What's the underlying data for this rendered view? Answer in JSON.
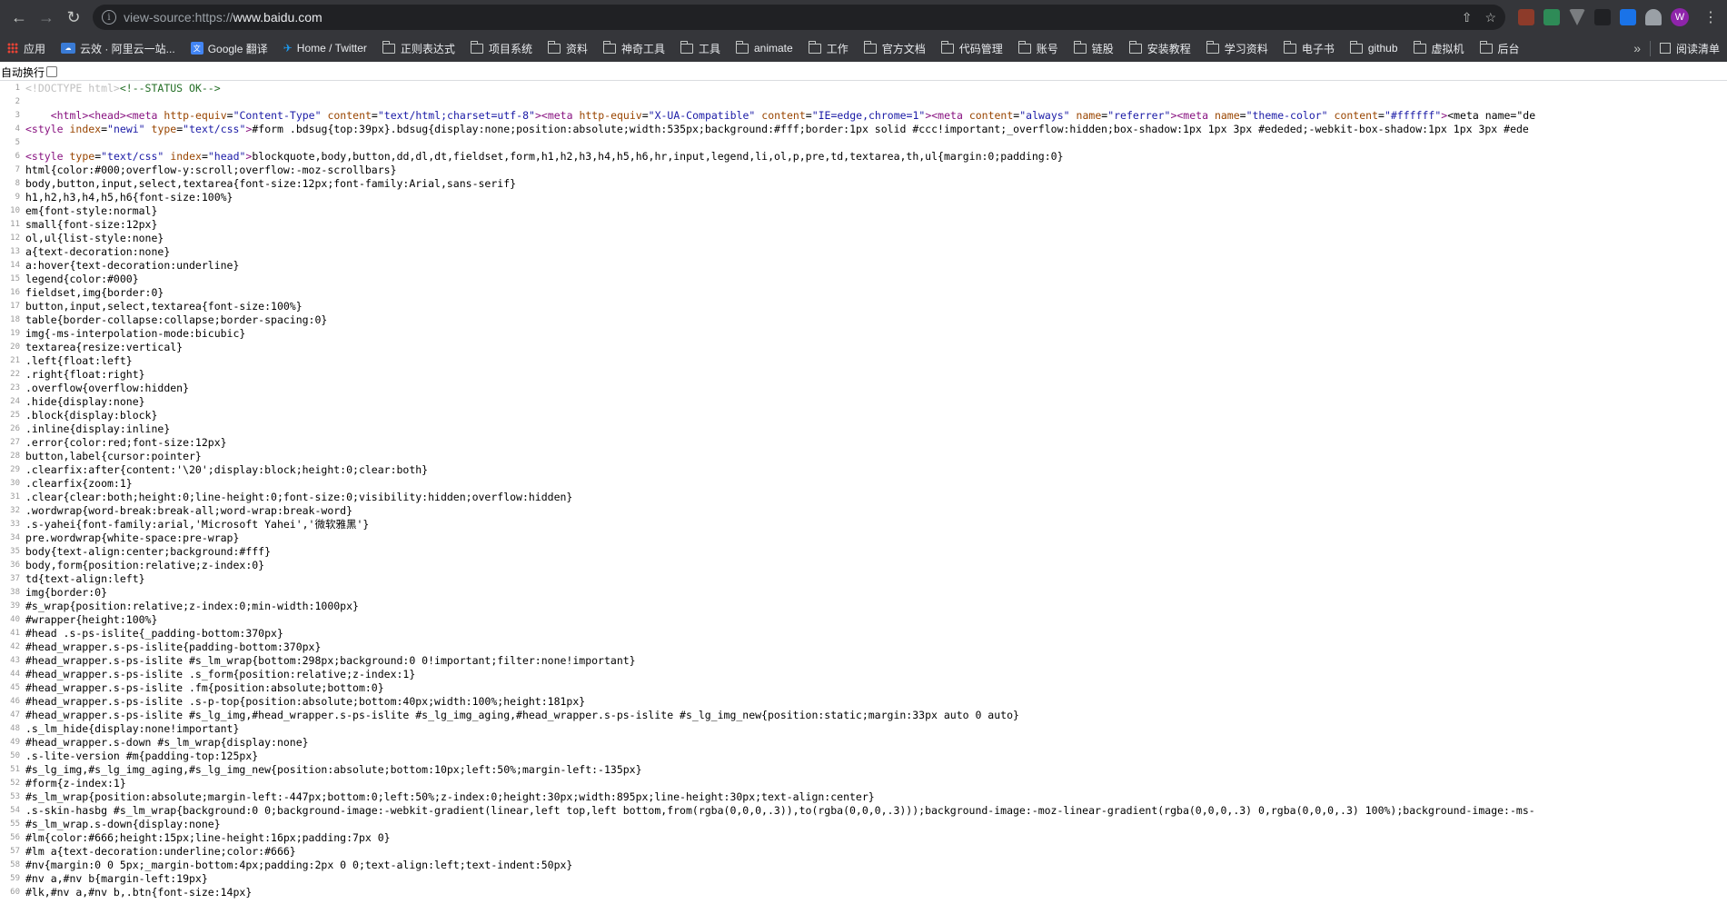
{
  "browser": {
    "url_scheme": "view-source:https://",
    "url_host": "www.baidu.com",
    "avatar_letter": "W",
    "bookmarks": [
      {
        "label": "应用",
        "icon": "apps-icon"
      },
      {
        "label": "云效 · 阿里云一站...",
        "icon": "aliyun-icon"
      },
      {
        "label": "Google 翻译",
        "icon": "google-translate-icon"
      },
      {
        "label": "Home / Twitter",
        "icon": "twitter-icon"
      },
      {
        "label": "正则表达式",
        "icon": "folder-icon"
      },
      {
        "label": "项目系统",
        "icon": "folder-icon"
      },
      {
        "label": "资料",
        "icon": "folder-icon"
      },
      {
        "label": "神奇工具",
        "icon": "folder-icon"
      },
      {
        "label": "工具",
        "icon": "folder-icon"
      },
      {
        "label": "animate",
        "icon": "folder-icon"
      },
      {
        "label": "工作",
        "icon": "folder-icon"
      },
      {
        "label": "官方文档",
        "icon": "folder-icon"
      },
      {
        "label": "代码管理",
        "icon": "folder-icon"
      },
      {
        "label": "账号",
        "icon": "folder-icon"
      },
      {
        "label": "链股",
        "icon": "folder-icon"
      },
      {
        "label": "安装教程",
        "icon": "folder-icon"
      },
      {
        "label": "学习资料",
        "icon": "folder-icon"
      },
      {
        "label": "电子书",
        "icon": "folder-icon"
      },
      {
        "label": "github",
        "icon": "folder-icon"
      },
      {
        "label": "虚拟机",
        "icon": "folder-icon"
      },
      {
        "label": "后台",
        "icon": "folder-icon"
      }
    ],
    "bookmarks_more": "»",
    "reading_list": "阅读清单"
  },
  "wrap_toggle_label": "自动换行",
  "source_lines": [
    {
      "n": "1",
      "t": "<!DOCTYPE html><!--STATUS OK-->"
    },
    {
      "n": "2",
      "t": ""
    },
    {
      "n": "3",
      "t": "    <html><head><meta http-equiv=\"Content-Type\" content=\"text/html;charset=utf-8\"><meta http-equiv=\"X-UA-Compatible\" content=\"IE=edge,chrome=1\"><meta content=\"always\" name=\"referrer\"><meta name=\"theme-color\" content=\"#ffffff\"><meta name=\"de"
    },
    {
      "n": "4",
      "t": "<style index=\"newi\" type=\"text/css\">#form .bdsug{top:39px}.bdsug{display:none;position:absolute;width:535px;background:#fff;border:1px solid #ccc!important;_overflow:hidden;box-shadow:1px 1px 3px #ededed;-webkit-box-shadow:1px 1px 3px #ede"
    },
    {
      "n": "5",
      "t": ""
    },
    {
      "n": "6",
      "t": "<style type=\"text/css\" index=\"head\">blockquote,body,button,dd,dl,dt,fieldset,form,h1,h2,h3,h4,h5,h6,hr,input,legend,li,ol,p,pre,td,textarea,th,ul{margin:0;padding:0}"
    },
    {
      "n": "7",
      "t": "html{color:#000;overflow-y:scroll;overflow:-moz-scrollbars}"
    },
    {
      "n": "8",
      "t": "body,button,input,select,textarea{font-size:12px;font-family:Arial,sans-serif}"
    },
    {
      "n": "9",
      "t": "h1,h2,h3,h4,h5,h6{font-size:100%}"
    },
    {
      "n": "10",
      "t": "em{font-style:normal}"
    },
    {
      "n": "11",
      "t": "small{font-size:12px}"
    },
    {
      "n": "12",
      "t": "ol,ul{list-style:none}"
    },
    {
      "n": "13",
      "t": "a{text-decoration:none}"
    },
    {
      "n": "14",
      "t": "a:hover{text-decoration:underline}"
    },
    {
      "n": "15",
      "t": "legend{color:#000}"
    },
    {
      "n": "16",
      "t": "fieldset,img{border:0}"
    },
    {
      "n": "17",
      "t": "button,input,select,textarea{font-size:100%}"
    },
    {
      "n": "18",
      "t": "table{border-collapse:collapse;border-spacing:0}"
    },
    {
      "n": "19",
      "t": "img{-ms-interpolation-mode:bicubic}"
    },
    {
      "n": "20",
      "t": "textarea{resize:vertical}"
    },
    {
      "n": "21",
      "t": ".left{float:left}"
    },
    {
      "n": "22",
      "t": ".right{float:right}"
    },
    {
      "n": "23",
      "t": ".overflow{overflow:hidden}"
    },
    {
      "n": "24",
      "t": ".hide{display:none}"
    },
    {
      "n": "25",
      "t": ".block{display:block}"
    },
    {
      "n": "26",
      "t": ".inline{display:inline}"
    },
    {
      "n": "27",
      "t": ".error{color:red;font-size:12px}"
    },
    {
      "n": "28",
      "t": "button,label{cursor:pointer}"
    },
    {
      "n": "29",
      "t": ".clearfix:after{content:'\\20';display:block;height:0;clear:both}"
    },
    {
      "n": "30",
      "t": ".clearfix{zoom:1}"
    },
    {
      "n": "31",
      "t": ".clear{clear:both;height:0;line-height:0;font-size:0;visibility:hidden;overflow:hidden}"
    },
    {
      "n": "32",
      "t": ".wordwrap{word-break:break-all;word-wrap:break-word}"
    },
    {
      "n": "33",
      "t": ".s-yahei{font-family:arial,'Microsoft Yahei','微软雅黑'}"
    },
    {
      "n": "34",
      "t": "pre.wordwrap{white-space:pre-wrap}"
    },
    {
      "n": "35",
      "t": "body{text-align:center;background:#fff}"
    },
    {
      "n": "36",
      "t": "body,form{position:relative;z-index:0}"
    },
    {
      "n": "37",
      "t": "td{text-align:left}"
    },
    {
      "n": "38",
      "t": "img{border:0}"
    },
    {
      "n": "39",
      "t": "#s_wrap{position:relative;z-index:0;min-width:1000px}"
    },
    {
      "n": "40",
      "t": "#wrapper{height:100%}"
    },
    {
      "n": "41",
      "t": "#head .s-ps-islite{_padding-bottom:370px}"
    },
    {
      "n": "42",
      "t": "#head_wrapper.s-ps-islite{padding-bottom:370px}"
    },
    {
      "n": "43",
      "t": "#head_wrapper.s-ps-islite #s_lm_wrap{bottom:298px;background:0 0!important;filter:none!important}"
    },
    {
      "n": "44",
      "t": "#head_wrapper.s-ps-islite .s_form{position:relative;z-index:1}"
    },
    {
      "n": "45",
      "t": "#head_wrapper.s-ps-islite .fm{position:absolute;bottom:0}"
    },
    {
      "n": "46",
      "t": "#head_wrapper.s-ps-islite .s-p-top{position:absolute;bottom:40px;width:100%;height:181px}"
    },
    {
      "n": "47",
      "t": "#head_wrapper.s-ps-islite #s_lg_img,#head_wrapper.s-ps-islite #s_lg_img_aging,#head_wrapper.s-ps-islite #s_lg_img_new{position:static;margin:33px auto 0 auto}"
    },
    {
      "n": "48",
      "t": ".s_lm_hide{display:none!important}"
    },
    {
      "n": "49",
      "t": "#head_wrapper.s-down #s_lm_wrap{display:none}"
    },
    {
      "n": "50",
      "t": ".s-lite-version #m{padding-top:125px}"
    },
    {
      "n": "51",
      "t": "#s_lg_img,#s_lg_img_aging,#s_lg_img_new{position:absolute;bottom:10px;left:50%;margin-left:-135px}"
    },
    {
      "n": "52",
      "t": "#form{z-index:1}"
    },
    {
      "n": "53",
      "t": "#s_lm_wrap{position:absolute;margin-left:-447px;bottom:0;left:50%;z-index:0;height:30px;width:895px;line-height:30px;text-align:center}"
    },
    {
      "n": "54",
      "t": ".s-skin-hasbg #s_lm_wrap{background:0 0;background-image:-webkit-gradient(linear,left top,left bottom,from(rgba(0,0,0,.3)),to(rgba(0,0,0,.3)));background-image:-moz-linear-gradient(rgba(0,0,0,.3) 0,rgba(0,0,0,.3) 100%);background-image:-ms-"
    },
    {
      "n": "55",
      "t": "#s_lm_wrap.s-down{display:none}"
    },
    {
      "n": "56",
      "t": "#lm{color:#666;height:15px;line-height:16px;padding:7px 0}"
    },
    {
      "n": "57",
      "t": "#lm a{text-decoration:underline;color:#666}"
    },
    {
      "n": "58",
      "t": "#nv{margin:0 0 5px;_margin-bottom:4px;padding:2px 0 0;text-align:left;text-indent:50px}"
    },
    {
      "n": "59",
      "t": "#nv a,#nv b{margin-left:19px}"
    },
    {
      "n": "60",
      "t": "#lk,#nv a,#nv b,.btn{font-size:14px}"
    }
  ]
}
